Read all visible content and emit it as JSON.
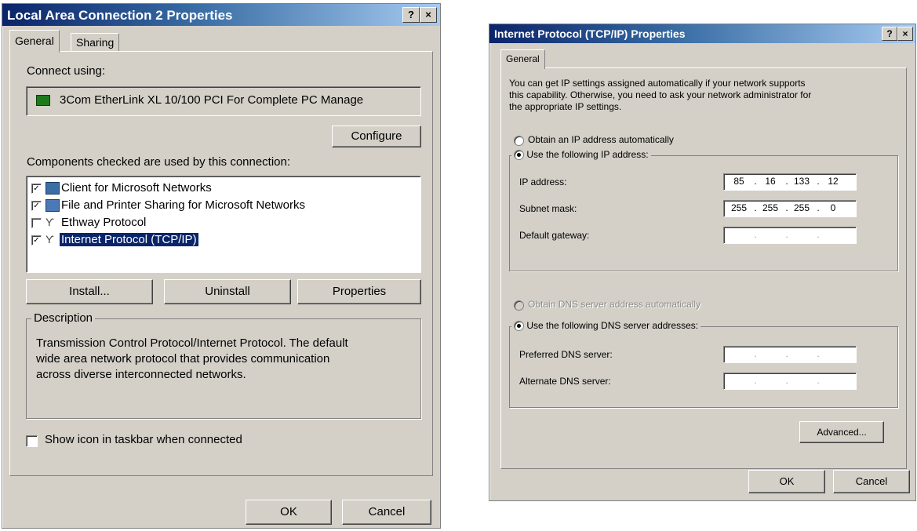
{
  "left_dialog": {
    "title": "Local Area Connection 2 Properties",
    "help_btn": "?",
    "close_btn": "×",
    "tabs": [
      {
        "label": "General"
      },
      {
        "label": "Sharing"
      }
    ],
    "connect_using_label": "Connect using:",
    "adapter_name": "3Com EtherLink XL 10/100 PCI For Complete PC Manage",
    "configure_label": "Configure",
    "components_label": "Components checked are used by this connection:",
    "components": [
      {
        "label": "Client for Microsoft Networks",
        "checked": true
      },
      {
        "label": "File and Printer Sharing for Microsoft Networks",
        "checked": true
      },
      {
        "label": "Ethway Protocol",
        "checked": false
      },
      {
        "label": "Internet Protocol (TCP/IP)",
        "checked": true
      }
    ],
    "install_label": "Install...",
    "uninstall_label": "Uninstall",
    "properties_label": "Properties",
    "description_legend": "Description",
    "description_text_1": "Transmission Control Protocol/Internet Protocol. The default",
    "description_text_2": "wide area network protocol that provides communication",
    "description_text_3": "across diverse interconnected networks.",
    "show_icon_label": "Show icon in taskbar when connected",
    "ok_label": "OK",
    "cancel_label": "Cancel"
  },
  "right_dialog": {
    "title": "Internet Protocol (TCP/IP) Properties",
    "help_btn": "?",
    "close_btn": "×",
    "tab_general": "General",
    "intro_1": "You can get IP settings assigned automatically if your network supports",
    "intro_2": "this capability. Otherwise, you need to ask your network administrator for",
    "intro_3": "the appropriate IP settings.",
    "obtain_ip_label": "Obtain an IP address automatically",
    "use_ip_label": "Use the following IP address:",
    "ip_address_label": "IP address:",
    "ip_address": [
      "85",
      "16",
      "133",
      "12"
    ],
    "subnet_label": "Subnet mask:",
    "subnet": [
      "255",
      "255",
      "255",
      "0"
    ],
    "gateway_label": "Default gateway:",
    "obtain_dns_label": "Obtain DNS server address automatically",
    "use_dns_label": "Use the following DNS server addresses:",
    "preferred_dns_label": "Preferred DNS server:",
    "alternate_dns_label": "Alternate DNS server:",
    "advanced_label": "Advanced...",
    "ok_label": "OK",
    "cancel_label": "Cancel"
  }
}
